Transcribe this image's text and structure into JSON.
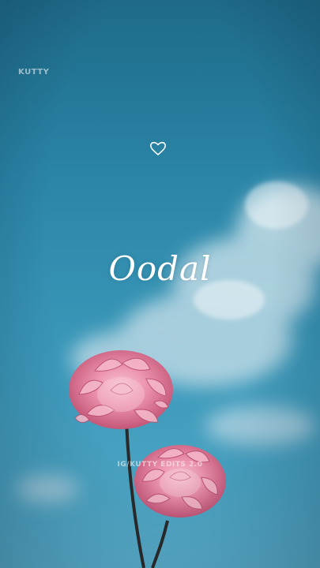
{
  "watermark_top": "KUTTY",
  "title": "Oodal",
  "watermark_bottom": "IG/KUTTY EDITS 2.0",
  "icons": {
    "heart": "heart-outline-icon"
  },
  "colors": {
    "sky_top": "#1e6a88",
    "sky_bottom": "#5aaecb",
    "flower_pink": "#e58aa6",
    "text": "#ffffff"
  }
}
